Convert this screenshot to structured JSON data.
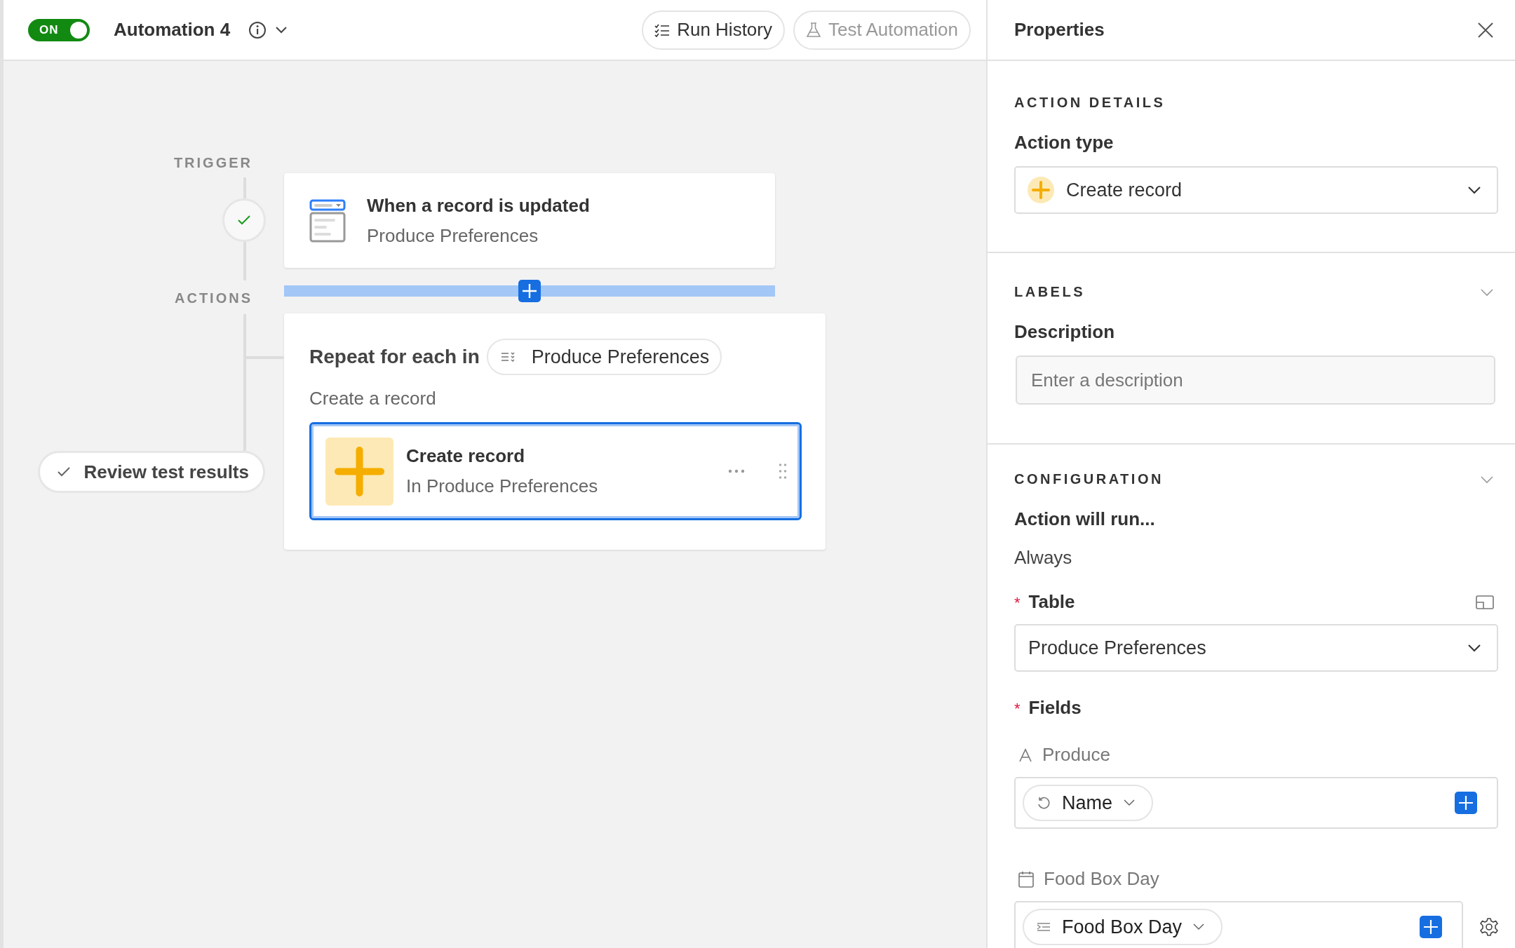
{
  "toolbar": {
    "toggle": {
      "label": "ON",
      "on": true
    },
    "title": "Automation 4",
    "buttons": [
      {
        "label": "Run History",
        "disabled": false
      },
      {
        "label": "Test Automation",
        "disabled": true
      }
    ]
  },
  "canvas": {
    "trigger_label": "TRIGGER",
    "trigger": {
      "title": "When a record is updated",
      "subtitle": "Produce Preferences"
    },
    "actions_label": "ACTIONS",
    "repeat": {
      "label": "Repeat for each in",
      "source": "Produce Preferences",
      "subtitle": "Create a record",
      "action": {
        "title": "Create record",
        "subtitle": "In Produce Preferences",
        "selected": true
      }
    },
    "review_button": "Review test results"
  },
  "properties": {
    "title": "Properties",
    "action_details": {
      "heading": "ACTION DETAILS",
      "label": "Action type",
      "value": "Create record"
    },
    "labels": {
      "heading": "LABELS",
      "label": "Description",
      "placeholder": "Enter a description"
    },
    "configuration": {
      "heading": "CONFIGURATION",
      "run_label": "Action will run...",
      "run_value": "Always",
      "table_label": "Table",
      "table_mark": "*",
      "table_value": "Produce Preferences",
      "fields_label": "Fields",
      "fields_mark": "*",
      "fields": [
        {
          "kind": "text",
          "name": "Produce",
          "value": "Name",
          "settings": false
        },
        {
          "kind": "date",
          "name": "Food Box Day",
          "value": "Food Box Day",
          "settings": true
        }
      ]
    }
  }
}
